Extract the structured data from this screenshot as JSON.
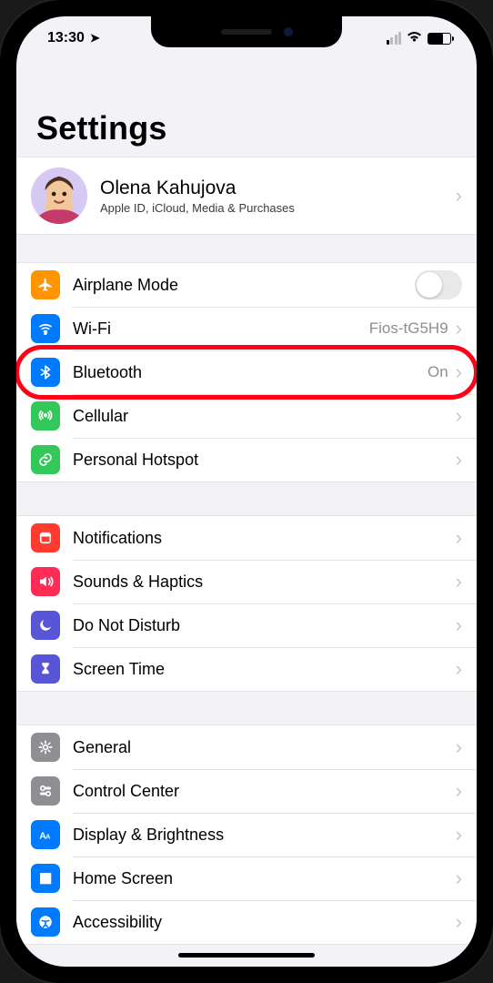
{
  "status": {
    "time": "13:30",
    "location_indicator": "➤"
  },
  "page": {
    "title": "Settings"
  },
  "profile": {
    "name": "Olena Kahujova",
    "subtitle": "Apple ID, iCloud, Media & Purchases"
  },
  "groups": [
    {
      "rows": [
        {
          "id": "airplane-mode",
          "label": "Airplane Mode",
          "icon": "airplane",
          "bg": "bg-orange",
          "type": "toggle",
          "on": false
        },
        {
          "id": "wifi",
          "label": "Wi-Fi",
          "icon": "wifi",
          "bg": "bg-blue",
          "type": "link",
          "detail": "Fios-tG5H9"
        },
        {
          "id": "bluetooth",
          "label": "Bluetooth",
          "icon": "bluetooth",
          "bg": "bg-blue",
          "type": "link",
          "detail": "On",
          "highlight": true
        },
        {
          "id": "cellular",
          "label": "Cellular",
          "icon": "antenna",
          "bg": "bg-green",
          "type": "link"
        },
        {
          "id": "personal-hotspot",
          "label": "Personal Hotspot",
          "icon": "link",
          "bg": "bg-green",
          "type": "link"
        }
      ]
    },
    {
      "rows": [
        {
          "id": "notifications",
          "label": "Notifications",
          "icon": "bell",
          "bg": "bg-red",
          "type": "link"
        },
        {
          "id": "sounds-haptics",
          "label": "Sounds & Haptics",
          "icon": "speaker",
          "bg": "bg-pink",
          "type": "link"
        },
        {
          "id": "do-not-disturb",
          "label": "Do Not Disturb",
          "icon": "moon",
          "bg": "bg-indigo",
          "type": "link"
        },
        {
          "id": "screen-time",
          "label": "Screen Time",
          "icon": "hourglass",
          "bg": "bg-indigo",
          "type": "link"
        }
      ]
    },
    {
      "rows": [
        {
          "id": "general",
          "label": "General",
          "icon": "gear",
          "bg": "bg-gray",
          "type": "link"
        },
        {
          "id": "control-center",
          "label": "Control Center",
          "icon": "switches",
          "bg": "bg-gray",
          "type": "link"
        },
        {
          "id": "display-brightness",
          "label": "Display & Brightness",
          "icon": "text-size",
          "bg": "bg-bluei",
          "type": "link"
        },
        {
          "id": "home-screen",
          "label": "Home Screen",
          "icon": "grid",
          "bg": "bg-blue",
          "type": "link"
        },
        {
          "id": "accessibility",
          "label": "Accessibility",
          "icon": "accessibility",
          "bg": "bg-blue",
          "type": "link",
          "cut": true
        }
      ]
    }
  ]
}
